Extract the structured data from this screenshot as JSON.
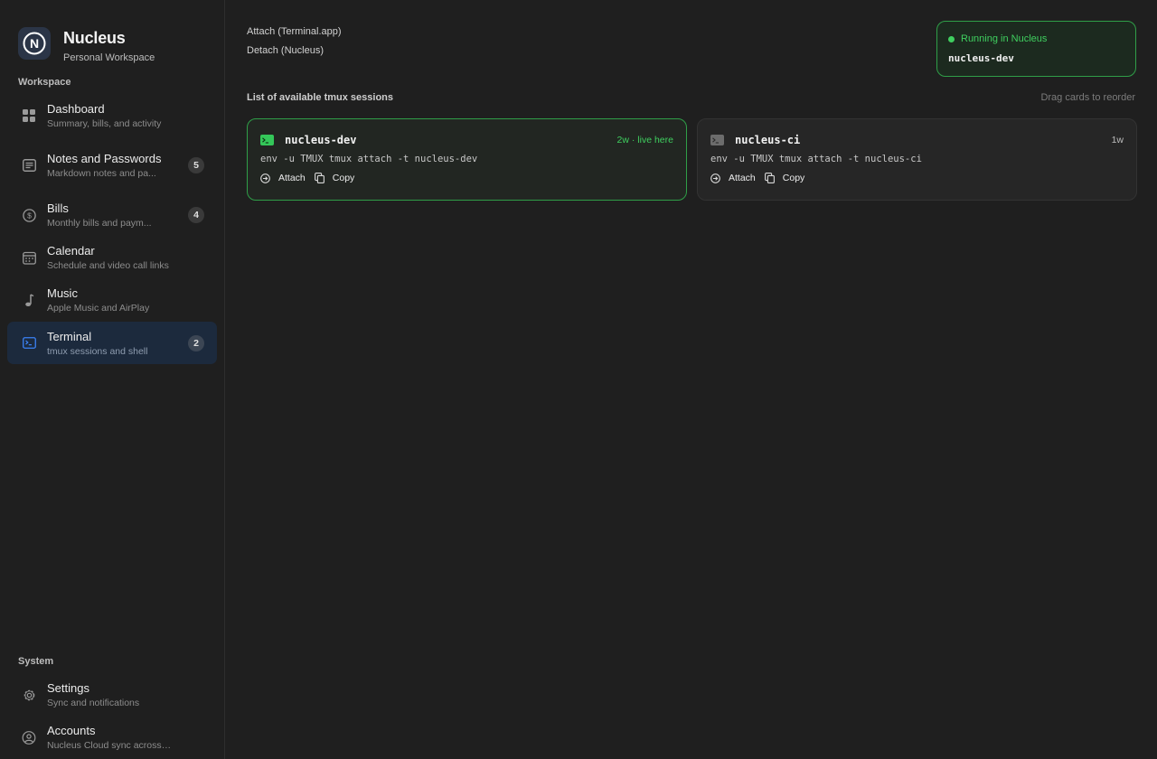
{
  "brand": {
    "name": "Nucleus",
    "subtitle": "Personal Workspace",
    "logo_letter": "N"
  },
  "sidebar": {
    "workspace_label": "Workspace",
    "system_label": "System",
    "items": [
      {
        "title": "Dashboard",
        "subtitle": "Summary, bills, and activity",
        "icon": "dashboard-grid-icon",
        "badge": null,
        "active": false
      },
      {
        "title": "Notes and Passwords",
        "subtitle": "Markdown notes and pa...",
        "icon": "notes-icon",
        "badge": "5",
        "active": false
      },
      {
        "title": "Bills",
        "subtitle": "Monthly bills and paym...",
        "icon": "dollar-circle-icon",
        "badge": "4",
        "active": false
      },
      {
        "title": "Calendar",
        "subtitle": "Schedule and video call links",
        "icon": "calendar-icon",
        "badge": null,
        "active": false
      },
      {
        "title": "Music",
        "subtitle": "Apple Music and AirPlay",
        "icon": "music-note-icon",
        "badge": null,
        "active": false
      },
      {
        "title": "Terminal",
        "subtitle": "tmux sessions and shell",
        "icon": "terminal-icon",
        "badge": "2",
        "active": true
      }
    ],
    "system_items": [
      {
        "title": "Settings",
        "subtitle": "Sync and notifications",
        "icon": "gear-icon"
      },
      {
        "title": "Accounts",
        "subtitle": "Nucleus Cloud sync across d...",
        "icon": "accounts-icon"
      }
    ]
  },
  "main": {
    "links": [
      "Attach (Terminal.app)",
      "Detach (Nucleus)"
    ],
    "running": {
      "status": "Running in Nucleus",
      "session": "nucleus-dev"
    },
    "list_heading": "List of available tmux sessions",
    "drag_hint": "Drag cards to reorder",
    "sessions": [
      {
        "name": "nucleus-dev",
        "age": "2w · live here",
        "command": "env -u TMUX tmux attach -t nucleus-dev",
        "live": true
      },
      {
        "name": "nucleus-ci",
        "age": "1w",
        "command": "env -u TMUX tmux attach -t nucleus-ci",
        "live": false
      }
    ],
    "actions": {
      "attach": "Attach",
      "copy": "Copy"
    }
  },
  "colors": {
    "background": "#1f1f1f",
    "accent_green": "#3fcf5f",
    "active_nav": "#1c2a3d",
    "terminal_blue": "#3b82f6"
  }
}
